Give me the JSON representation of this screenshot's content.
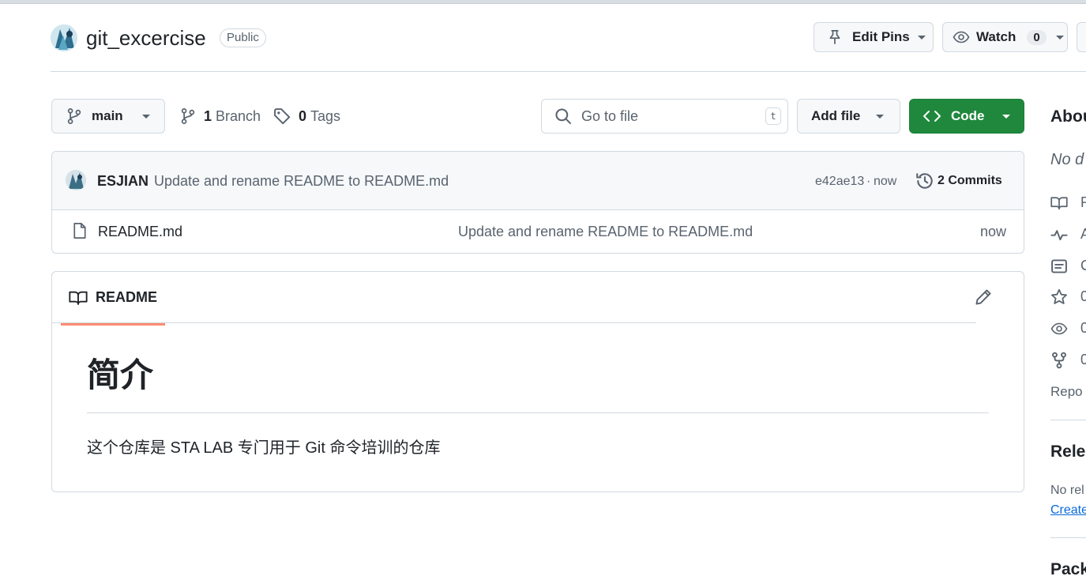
{
  "repo": {
    "name": "git_excercise",
    "visibility": "Public"
  },
  "header_actions": {
    "edit_pins": "Edit Pins",
    "watch": "Watch",
    "watch_count": "0"
  },
  "toolbar": {
    "branch": "main",
    "branch_count": "1",
    "branch_label": "Branch",
    "tag_count": "0",
    "tag_label": "Tags",
    "search_placeholder": "Go to file",
    "search_shortcut": "t",
    "add_file": "Add file",
    "code": "Code"
  },
  "latest_commit": {
    "author": "ESJIAN",
    "message": "Update and rename README to README.md",
    "hash": "e42ae13",
    "separator": "·",
    "time": "now",
    "commits_label": "2 Commits"
  },
  "files": [
    {
      "name": "README.md",
      "message": "Update and rename README to README.md",
      "time": "now"
    }
  ],
  "readme": {
    "tab": "README",
    "heading": "简介",
    "body": "这个仓库是 STA LAB 专门用于 Git 命令培训的仓库"
  },
  "sidebar": {
    "about_title": "Abou",
    "description": "No d",
    "items": [
      {
        "icon": "book-icon",
        "text": "R"
      },
      {
        "icon": "pulse-icon",
        "text": "A"
      },
      {
        "icon": "comment-icon",
        "text": "C"
      },
      {
        "icon": "star-icon",
        "text": "0"
      },
      {
        "icon": "eye-icon",
        "text": "0"
      },
      {
        "icon": "fork-icon",
        "text": "0"
      }
    ],
    "report": "Repo",
    "releases_title": "Relea",
    "no_releases": "No rel",
    "create_release": "Create",
    "packages_title": "Pack"
  },
  "colors": {
    "code_button": "#1f883d",
    "tab_underline": "#fd8c73",
    "link": "#0969da"
  }
}
